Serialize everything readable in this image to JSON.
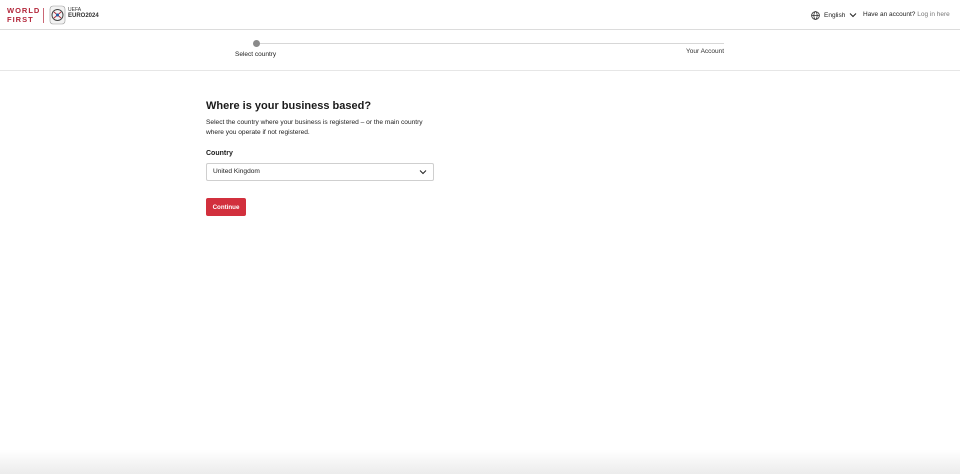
{
  "header": {
    "logo_line1": "WORLD",
    "logo_line2": "FIRST",
    "partner_small": "UEFA",
    "partner_big": "EURO2024",
    "language": "English",
    "account_prompt": "Have an account?",
    "login_label": "Log in here",
    "icons": {
      "language": "globe-icon",
      "language_toggle": "chevron-down-icon"
    }
  },
  "stepper": {
    "steps": [
      {
        "label": "Select country",
        "active": true
      },
      {
        "label": "Your Account",
        "active": false
      }
    ]
  },
  "form": {
    "title": "Where is your business based?",
    "description": "Select the country where your business is registered – or the main country where you operate if not registered.",
    "country_label": "Country",
    "country_value": "United Kingdom",
    "continue_label": "Continue"
  },
  "colors": {
    "brand": "#b3263a",
    "button": "#d2303d",
    "step_dot": "#8a8a8a"
  }
}
